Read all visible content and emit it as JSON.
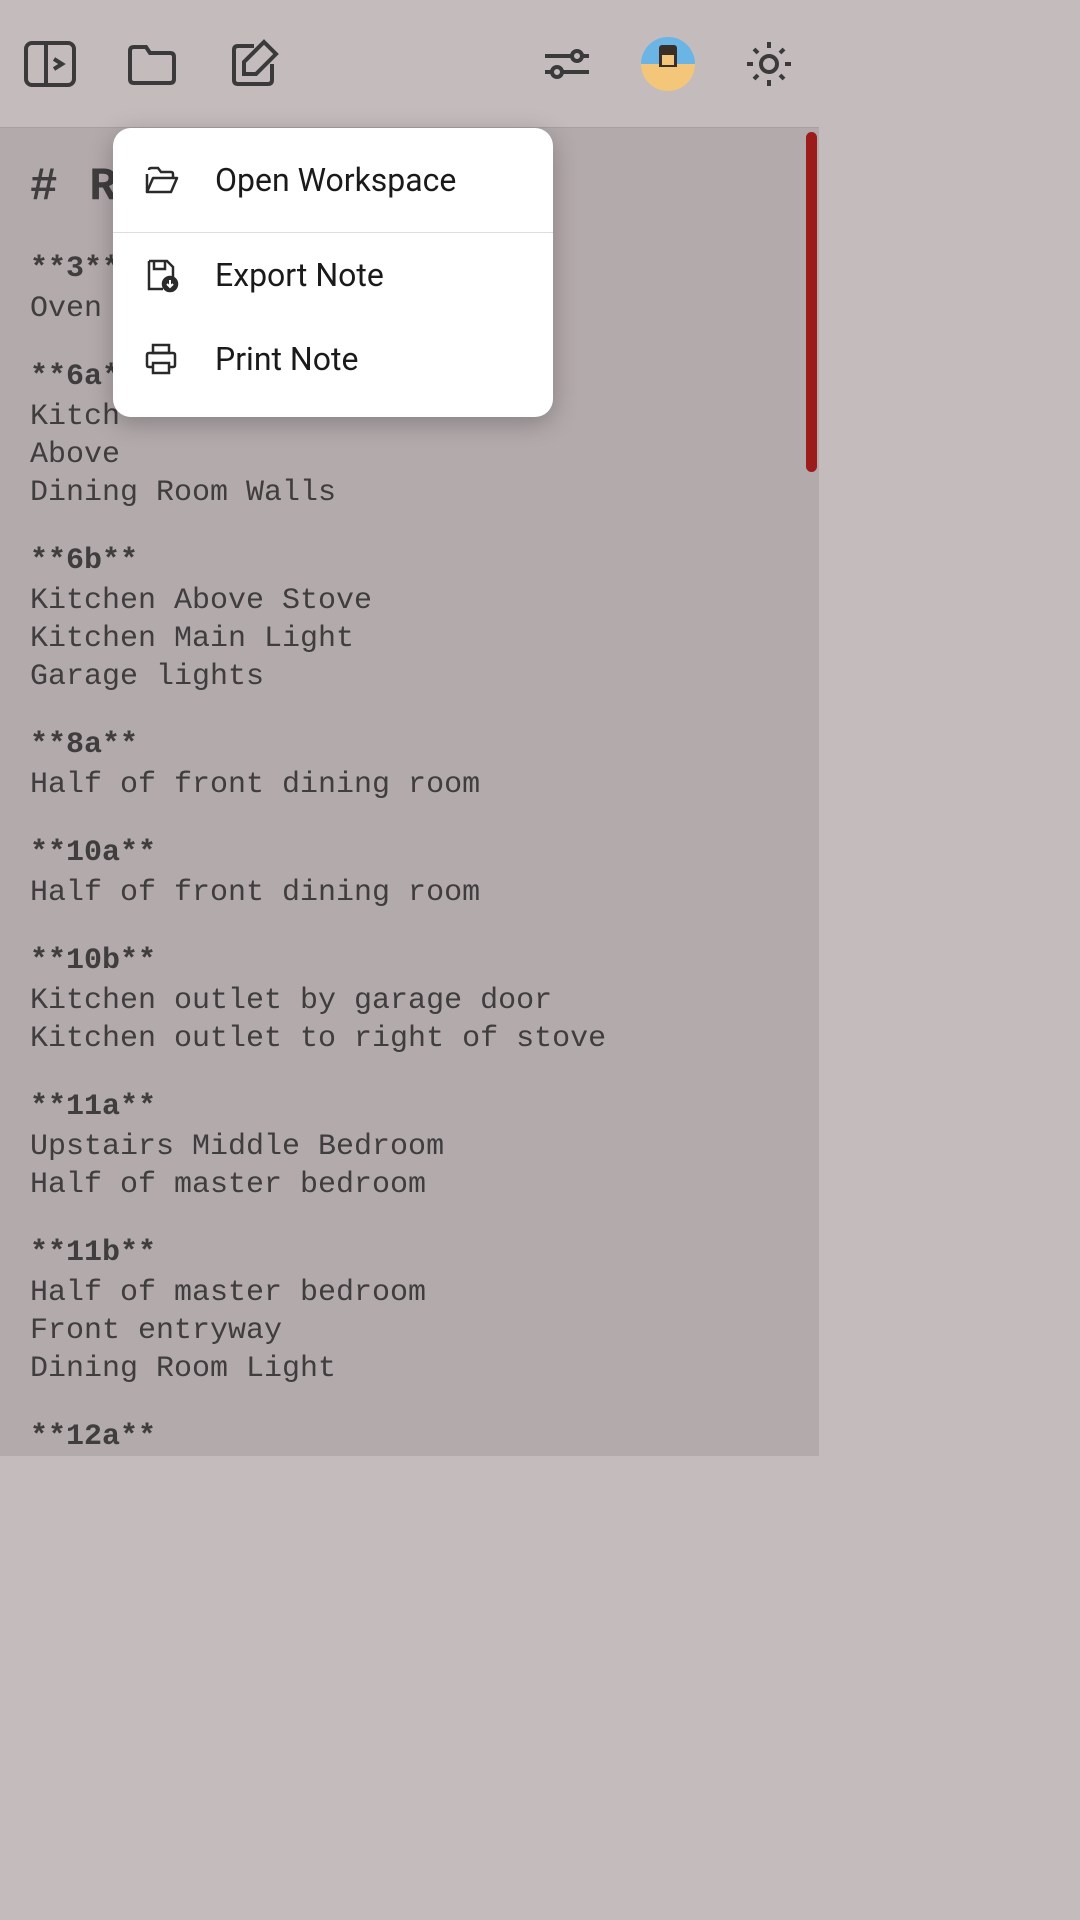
{
  "document": {
    "title_raw": "# R             rs",
    "sections": [
      {
        "head": "**3**",
        "lines": [
          "Oven"
        ]
      },
      {
        "head": "**6a*",
        "lines": [
          "Kitch",
          "Above",
          "Dining Room Walls"
        ]
      },
      {
        "head": "**6b**",
        "lines": [
          "Kitchen Above Stove",
          "Kitchen Main Light",
          "Garage lights"
        ]
      },
      {
        "head": "**8a**",
        "lines": [
          "Half of front dining room"
        ]
      },
      {
        "head": "**10a**",
        "lines": [
          "Half of front dining room"
        ]
      },
      {
        "head": "**10b**",
        "lines": [
          "Kitchen outlet by garage door",
          "Kitchen outlet to right of stove"
        ]
      },
      {
        "head": "**11a**",
        "lines": [
          "Upstairs Middle Bedroom",
          "Half of master bedroom"
        ]
      },
      {
        "head": "**11b**",
        "lines": [
          "Half of master bedroom",
          "Front entryway",
          "Dining Room Light"
        ]
      },
      {
        "head": "**12a**",
        "lines": []
      }
    ]
  },
  "popup": {
    "items": [
      {
        "icon": "folder-open",
        "label": "Open Workspace"
      },
      {
        "icon": "save-download",
        "label": "Export Note"
      },
      {
        "icon": "printer",
        "label": "Print Note"
      }
    ]
  },
  "toolbar": {
    "left_icons": [
      "sidebar-toggle",
      "folder",
      "edit-note"
    ],
    "right_icons": [
      "sliders",
      "avatar",
      "settings-gear"
    ]
  },
  "colors": {
    "background": "#c4bbbc",
    "popup_bg": "#ffffff",
    "scrollbar": "#9c1c1c",
    "text": "#2a2a2a"
  }
}
